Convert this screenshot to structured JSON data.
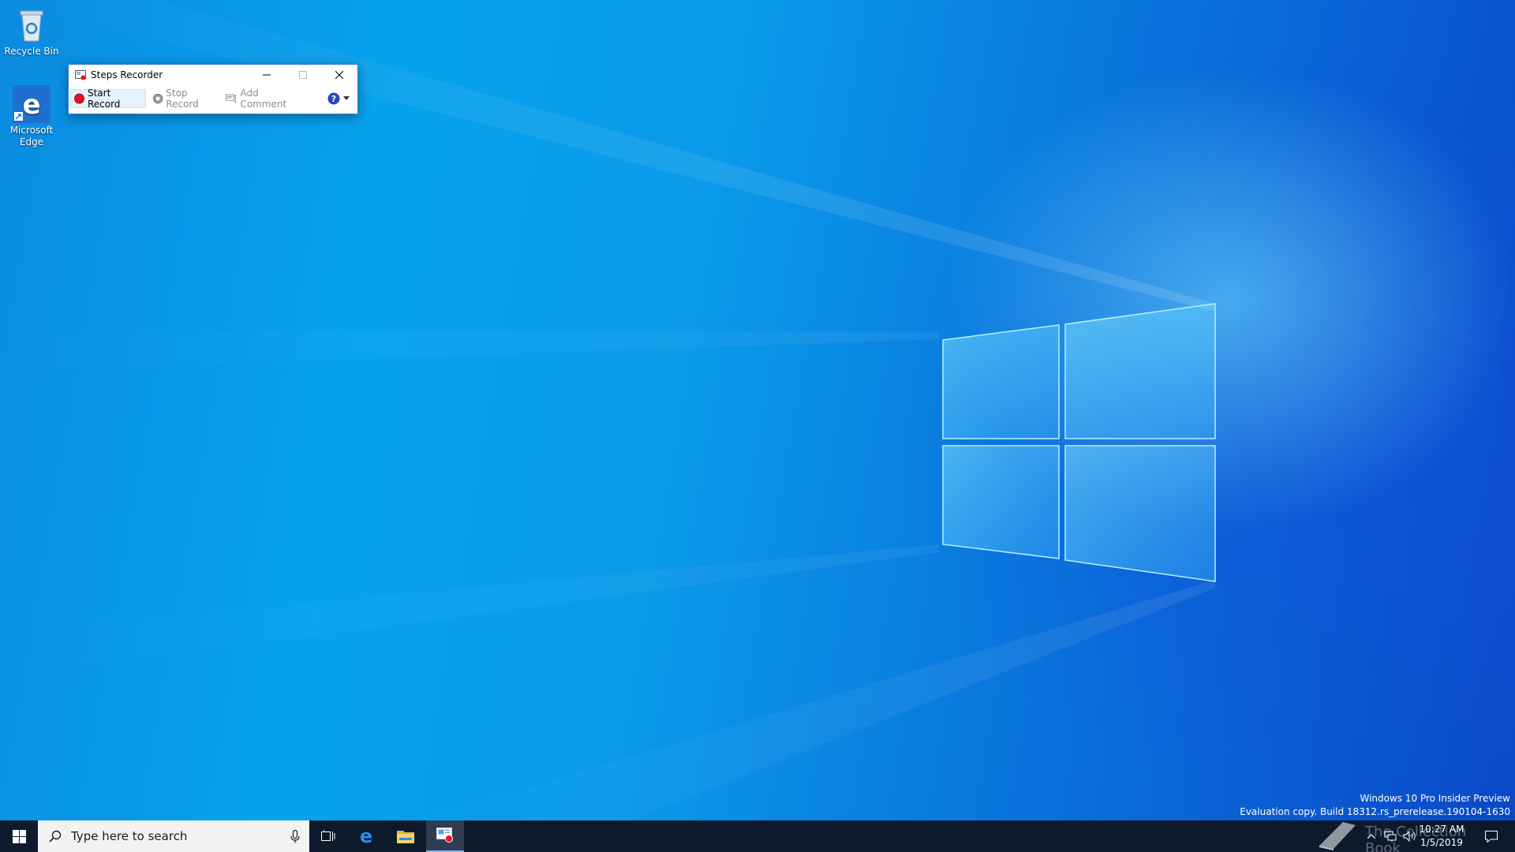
{
  "desktop": {
    "icons": [
      {
        "label": "Recycle Bin"
      },
      {
        "label": "Microsoft Edge"
      }
    ]
  },
  "steps_recorder": {
    "title": "Steps Recorder",
    "toolbar": {
      "start_label": "Start Record",
      "stop_label": "Stop Record",
      "comment_label": "Add Comment"
    }
  },
  "watermark": {
    "line1": "Windows 10 Pro Insider Preview",
    "line2": "Evaluation copy. Build 18312.rs_prerelease.190104-1630"
  },
  "taskbar": {
    "search_placeholder": "Type here to search",
    "clock_time": "10:27 AM",
    "clock_date": "1/5/2019"
  },
  "brand_text": "The Collection Book",
  "icons": {
    "start": "windows-logo-icon",
    "search": "search-icon",
    "mic": "microphone-icon",
    "task_view": "task-view-icon",
    "edge": "edge-icon",
    "explorer": "folder-icon",
    "steps": "steps-recorder-icon"
  },
  "colors": {
    "taskbar": "#0d1a2c",
    "accent": "#2b78d6",
    "record_red": "#e81123"
  }
}
